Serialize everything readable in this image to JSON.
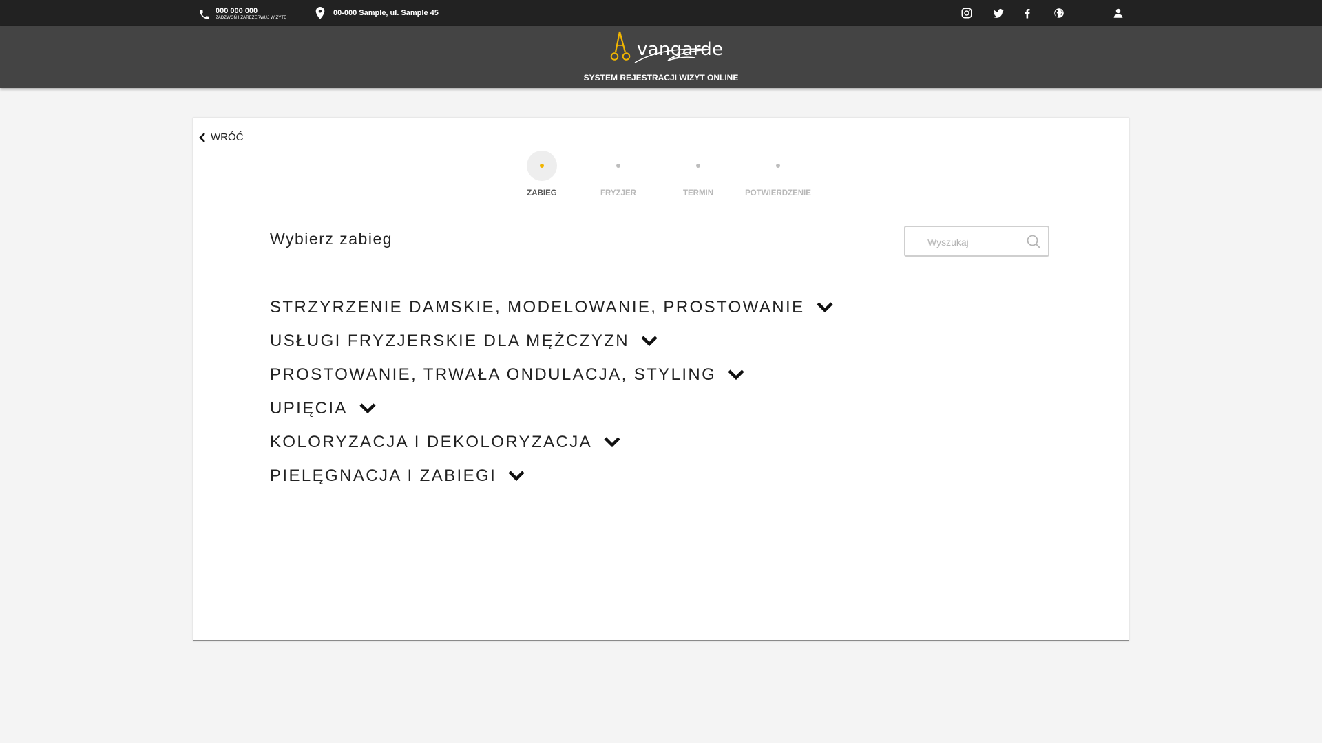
{
  "topbar": {
    "phone": "000 000 000",
    "phone_sub": "ZADZWOŃ I ZAREZERWUJ WIZYTĘ",
    "address": "00-000 Sample, ul. Sample 45",
    "icons": [
      "instagram-icon",
      "twitter-icon",
      "facebook-icon",
      "globe-icon",
      "user-icon"
    ]
  },
  "header": {
    "logo_text": "vangarde",
    "tagline": "SYSTEM REJESTRACJI WIZYT ONLINE",
    "accent_color": "#f1b500"
  },
  "back": {
    "label": "WRÓĆ"
  },
  "steps": [
    {
      "label": "ZABIEG",
      "active": true
    },
    {
      "label": "FRYZJER",
      "active": false
    },
    {
      "label": "TERMIN",
      "active": false
    },
    {
      "label": "POTWIERDZENIE",
      "active": false
    }
  ],
  "main": {
    "title": "Wybierz zabieg",
    "search_placeholder": "Wyszukaj",
    "search_value": "",
    "categories": [
      "STRZYRZENIE DAMSKIE, MODELOWANIE, PROSTOWANIE",
      "USŁUGI FRYZJERSKIE DLA MĘŻCZYZN",
      "PROSTOWANIE, TRWAŁA ONDULACJA, STYLING",
      "UPIĘCIA",
      "KOLORYZACJA I DEKOLORYZACJA",
      "PIELĘGNACJA I ZABIEGI"
    ]
  }
}
